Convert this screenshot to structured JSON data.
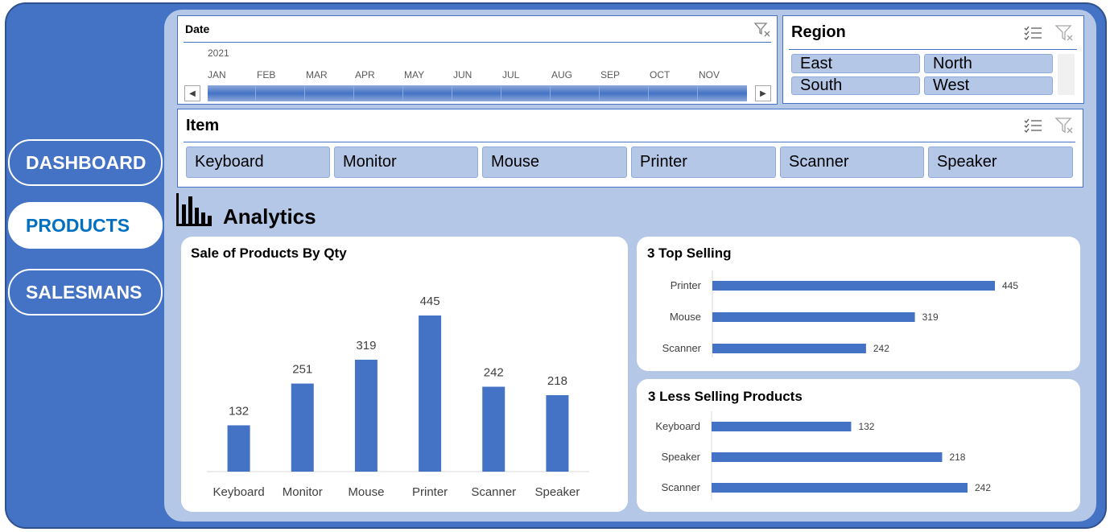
{
  "nav": {
    "dashboard": "DASHBOARD",
    "products": "PRODUCTS",
    "salesmans": "SALESMANS"
  },
  "date_slicer": {
    "title": "Date",
    "year": "2021",
    "months": [
      "JAN",
      "FEB",
      "MAR",
      "APR",
      "MAY",
      "JUN",
      "JUL",
      "AUG",
      "SEP",
      "OCT",
      "NOV"
    ],
    "scroll_left": "◀",
    "scroll_right": "▶"
  },
  "region_slicer": {
    "title": "Region",
    "items": [
      "East",
      "North",
      "South",
      "West"
    ]
  },
  "item_slicer": {
    "title": "Item",
    "items": [
      "Keyboard",
      "Monitor",
      "Mouse",
      "Printer",
      "Scanner",
      "Speaker"
    ]
  },
  "analytics": {
    "title": "Analytics"
  },
  "colors": {
    "accent": "#4472c4",
    "panel": "#b4c7e7",
    "active_nav_text": "#0070c0"
  },
  "chart_data": [
    {
      "type": "bar",
      "title": "Sale of Products By Qty",
      "categories": [
        "Keyboard",
        "Monitor",
        "Mouse",
        "Printer",
        "Scanner",
        "Speaker"
      ],
      "values": [
        132,
        251,
        319,
        445,
        242,
        218
      ],
      "ylim": [
        0,
        445
      ],
      "grid": false
    },
    {
      "type": "bar",
      "orientation": "horizontal",
      "title": "3 Top Selling",
      "categories": [
        "Printer",
        "Mouse",
        "Scanner"
      ],
      "values": [
        445,
        319,
        242
      ],
      "grid": false
    },
    {
      "type": "bar",
      "orientation": "horizontal",
      "title": "3 Less Selling Products",
      "categories": [
        "Keyboard",
        "Speaker",
        "Scanner"
      ],
      "values": [
        132,
        218,
        242
      ],
      "grid": false
    }
  ]
}
